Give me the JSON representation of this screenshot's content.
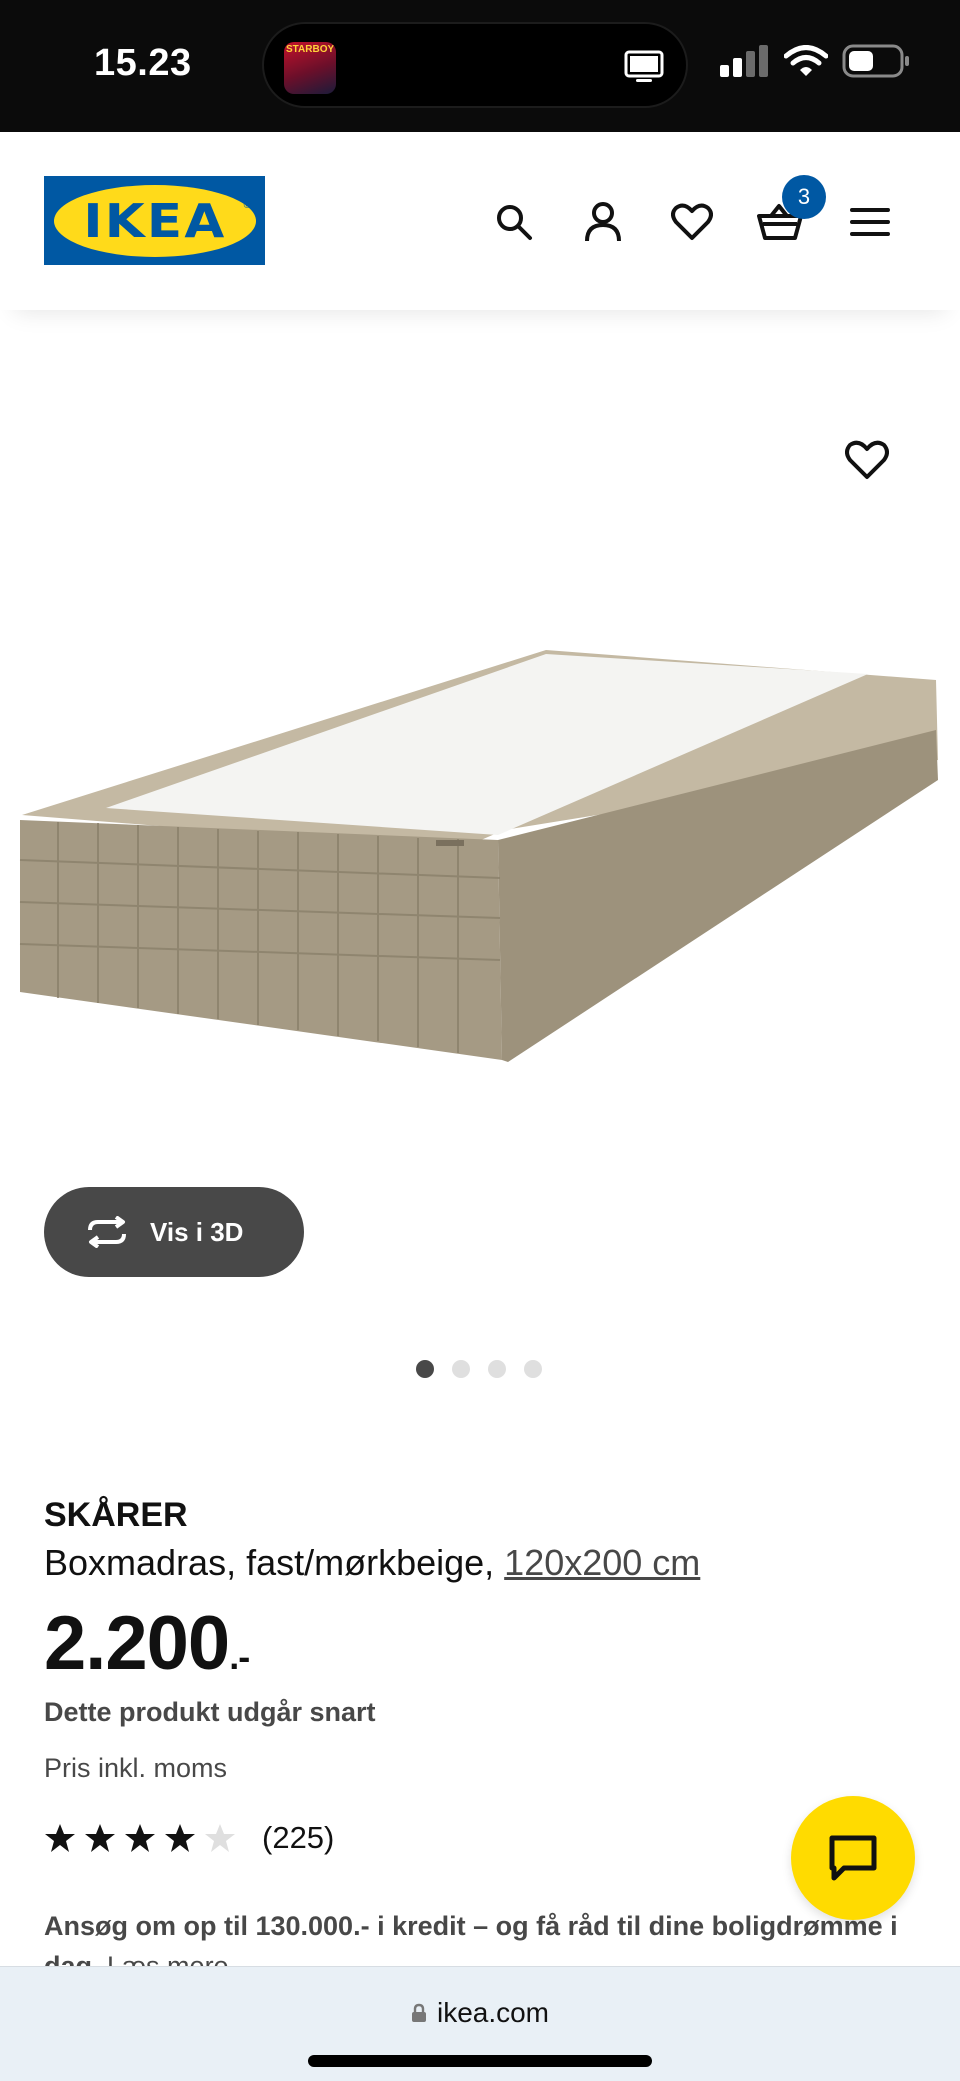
{
  "status_bar": {
    "time": "15.23",
    "now_playing_art_text": "STARBOY"
  },
  "header": {
    "logo_text": "IKEA",
    "logo_registered": "®",
    "icons": [
      "search-icon",
      "user-icon",
      "heart-icon",
      "cart-icon",
      "menu-icon"
    ],
    "cart_count": "3",
    "colors": {
      "brand_blue": "#0058a3",
      "brand_yellow": "#ffda1a"
    }
  },
  "gallery": {
    "view_3d_label": "Vis i 3D",
    "image_count": 4,
    "active_image": 1
  },
  "product": {
    "name": "SKÅRER",
    "description": "Boxmadras, fast/mørkbeige, ",
    "size_link": "120x200 cm",
    "price": "2.200",
    "price_suffix": ".-",
    "discontinued_notice": "Dette produkt udgår snart",
    "vat_note": "Pris inkl. moms",
    "rating": 4,
    "rating_max": 5,
    "review_count": "(225)",
    "credit_text": "Ansøg om op til 130.000.- i kredit – og få råd til dine boligdrømme i dag.",
    "credit_link": "Læs mere"
  },
  "chat": {
    "icon": "chat-icon",
    "color": "#ffdb00"
  },
  "browser": {
    "url": "ikea.com"
  }
}
